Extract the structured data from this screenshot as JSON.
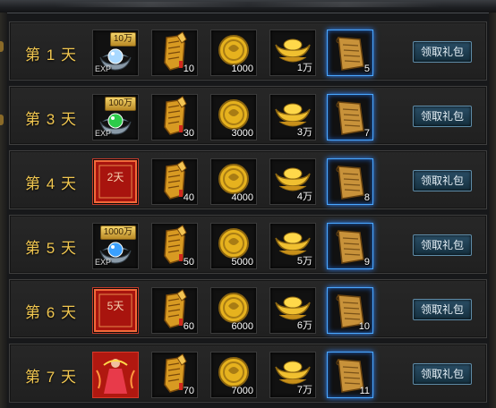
{
  "claim_label": "领取礼包",
  "rows": [
    {
      "day": "第 1 天",
      "first_kind": "exp",
      "first_badge": "10万",
      "first_sub": "EXP",
      "first_gem": "#a8d8ff",
      "scroll": "10",
      "coin": "1000",
      "ingot": "1万",
      "book": "5"
    },
    {
      "day": "第 3 天",
      "first_kind": "exp",
      "first_badge": "100万",
      "first_sub": "EXP",
      "first_gem": "#2ccc4a",
      "scroll": "30",
      "coin": "3000",
      "ingot": "3万",
      "book": "7"
    },
    {
      "day": "第 4 天",
      "first_kind": "card",
      "first_text": "2天",
      "scroll": "40",
      "coin": "4000",
      "ingot": "4万",
      "book": "8"
    },
    {
      "day": "第 5 天",
      "first_kind": "exp",
      "first_badge": "1000万",
      "first_sub": "EXP",
      "first_gem": "#3aa0ff",
      "scroll": "50",
      "coin": "5000",
      "ingot": "5万",
      "book": "9"
    },
    {
      "day": "第 6 天",
      "first_kind": "card",
      "first_text": "5天",
      "scroll": "60",
      "coin": "6000",
      "ingot": "6万",
      "book": "10"
    },
    {
      "day": "第 7 天",
      "first_kind": "figure",
      "scroll": "70",
      "coin": "7000",
      "ingot": "7万",
      "book": "11"
    }
  ]
}
